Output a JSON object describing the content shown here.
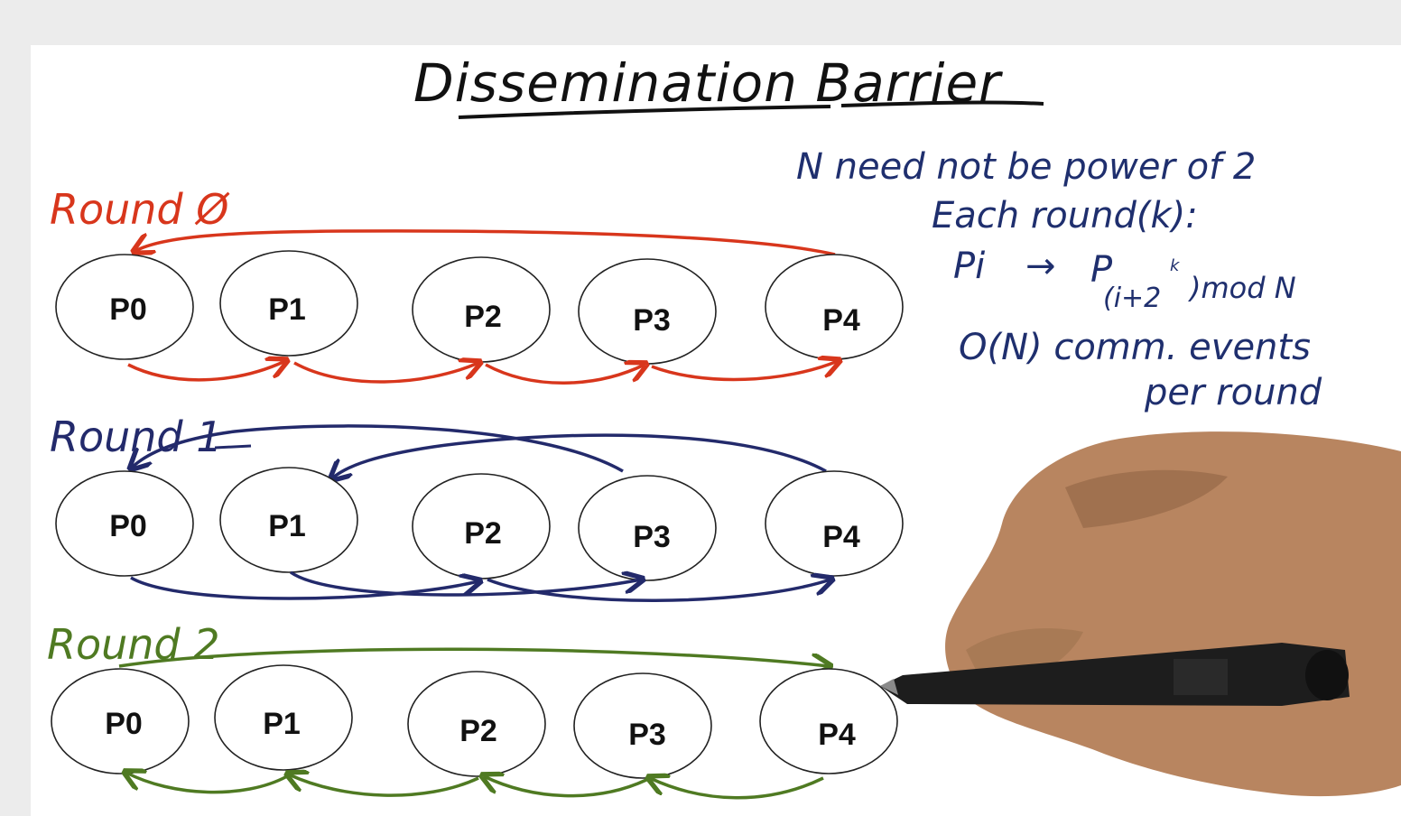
{
  "title": "Dissemination Barrier",
  "colors": {
    "round0": "#d8361c",
    "round1": "#232a6b",
    "round2": "#4f7a22",
    "notes": "#1f2f6e",
    "ink": "#111111",
    "canvas": "#ffffff",
    "frame": "#ececec"
  },
  "rounds": [
    {
      "label": "Round Ø",
      "nodes": [
        "P0",
        "P1",
        "P2",
        "P3",
        "P4"
      ]
    },
    {
      "label": "Round 1",
      "nodes": [
        "P0",
        "P1",
        "P2",
        "P3",
        "P4"
      ]
    },
    {
      "label": "Round 2",
      "nodes": [
        "P0",
        "P1",
        "P2",
        "P3",
        "P4"
      ]
    }
  ],
  "notes": {
    "line1": "N need not be power of 2",
    "line2": "Each round(k):",
    "formula_from": "Pi",
    "formula_arrow": "→",
    "formula_to": "P",
    "formula_subscript": "(i+2",
    "formula_exp": "k",
    "formula_tail": ")mod N",
    "line4": "O(N) comm. events",
    "line5": "per round"
  }
}
